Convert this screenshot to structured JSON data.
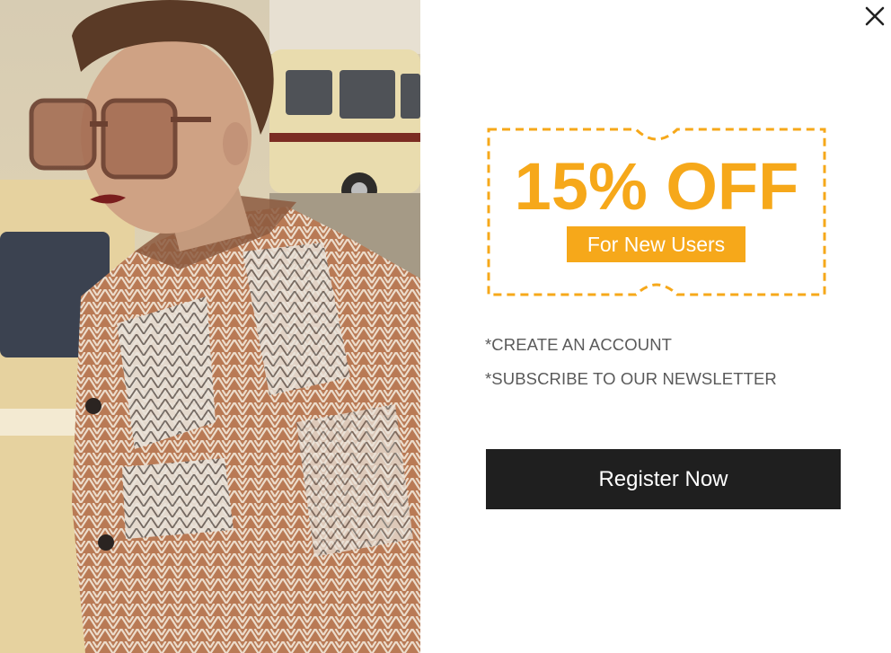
{
  "popup": {
    "close_icon": "close-icon",
    "image_alt": "model-photo",
    "coupon": {
      "headline": "15% OFF",
      "tag": "For New Users",
      "accent_color": "#f6a81a"
    },
    "benefits": [
      "*CREATE AN ACCOUNT",
      "*SUBSCRIBE TO OUR NEWSLETTER"
    ],
    "cta_label": "Register Now",
    "cta_color": "#1f1f1f"
  }
}
